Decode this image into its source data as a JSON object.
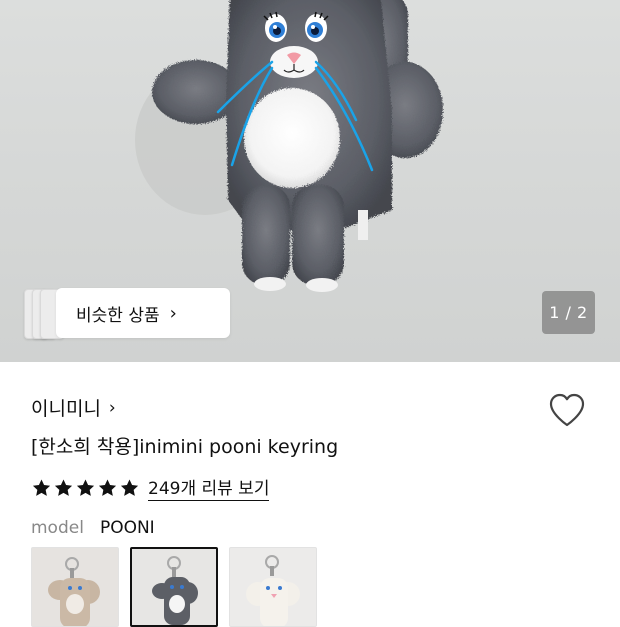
{
  "gallery": {
    "similar_button_label": "비슷한 상품",
    "similar_chevron": "›",
    "counter": "1 / 2",
    "current_image": 1,
    "total_images": 2
  },
  "product": {
    "brand": "이니미니",
    "brand_chevron": "›",
    "title": "[한소희 착용]inimini pooni keyring",
    "rating_stars": 5,
    "review_link": "249개 리뷰 보기",
    "like_icon": "heart-outline-icon"
  },
  "options": {
    "label": "model",
    "selected_value": "POONI",
    "thumbnails": [
      {
        "name": "beige-bunny-keyring",
        "selected": false,
        "fur_color": "#c9b8a6"
      },
      {
        "name": "gray-bunny-keyring",
        "selected": true,
        "fur_color": "#5b5d66"
      },
      {
        "name": "white-bunny-keyring",
        "selected": false,
        "fur_color": "#ece9e4"
      }
    ]
  },
  "colors": {
    "star": "#111111",
    "text_primary": "#111111",
    "text_muted": "#888888",
    "hero_bg": "#d6d8d7",
    "plush_gray": "#5c5f66",
    "whisker_blue": "#1aa3e8"
  }
}
